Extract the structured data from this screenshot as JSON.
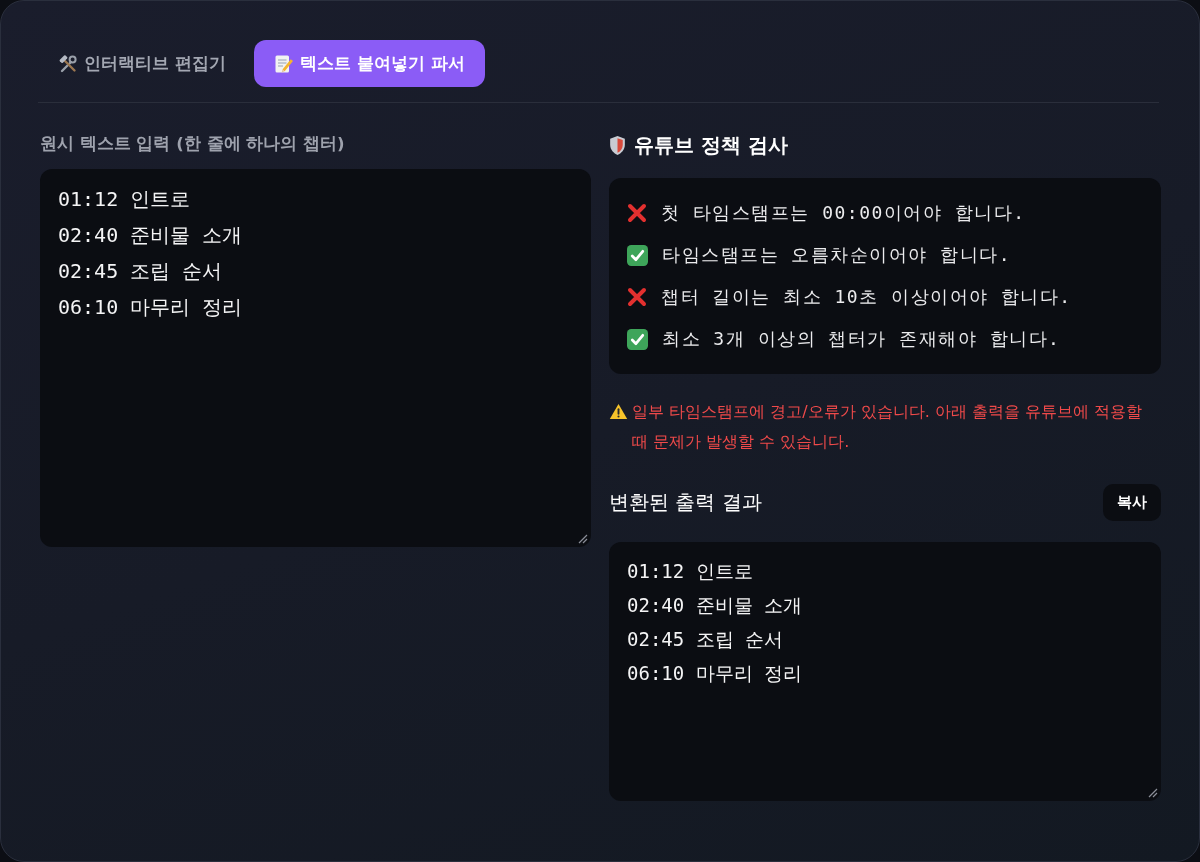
{
  "tabs": [
    {
      "label": "인터랙티브 편집기",
      "selected": false
    },
    {
      "label": "텍스트 붙여넣기 파서",
      "selected": true
    }
  ],
  "input": {
    "label": "원시 텍스트 입력 (한 줄에 하나의 챕터)",
    "lines": [
      "01:12 인트로",
      "02:40 준비물 소개",
      "02:45 조립 순서",
      "06:10 마무리 정리"
    ]
  },
  "policy_check": {
    "title": "유튜브 정책 검사",
    "rules": [
      {
        "text": "첫 타임스탬프는 00:00이어야 합니다.",
        "passed": false
      },
      {
        "text": "타임스탬프는 오름차순이어야 합니다.",
        "passed": true
      },
      {
        "text": "챕터 길이는 최소 10초 이상이어야 합니다.",
        "passed": false
      },
      {
        "text": "최소 3개 이상의 챕터가 존재해야 합니다.",
        "passed": true
      }
    ]
  },
  "warning": {
    "text": "일부 타임스탬프에 경고/오류가 있습니다. 아래 출력을 유튜브에 적용할 때 문제가 발생할 수 있습니다."
  },
  "output": {
    "title": "변환된 출력 결과",
    "copy_button": "복사",
    "lines": [
      "01:12 인트로",
      "02:40 준비물 소개",
      "02:45 조립 순서",
      "06:10 마무리 정리"
    ]
  }
}
